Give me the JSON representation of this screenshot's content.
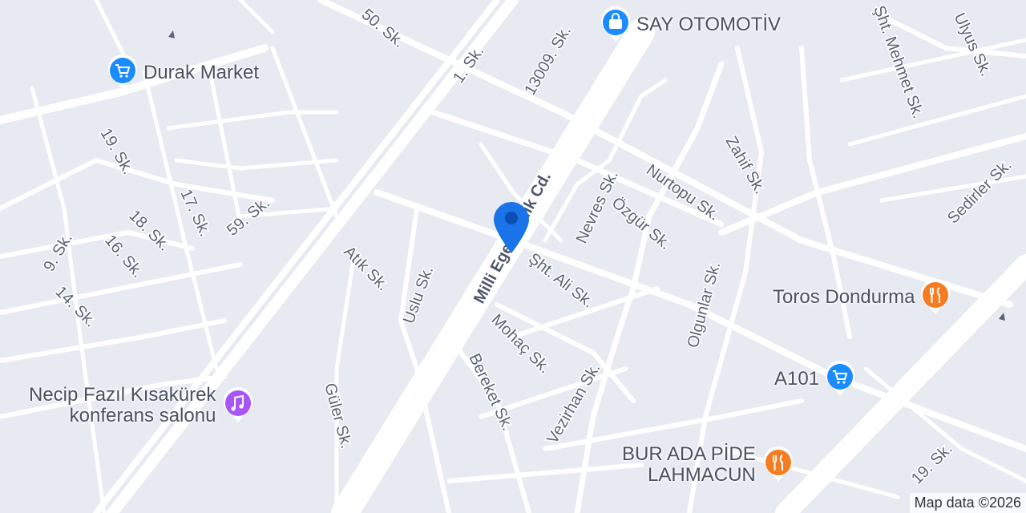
{
  "map": {
    "colors": {
      "background": "#e8eaf1",
      "road": "#ffffff",
      "text": "#5b6477",
      "pin": "#1a73e8",
      "shop": "#1a8cff",
      "food": "#f57c20",
      "music": "#a855f7"
    },
    "attribution": "Map data ©2026"
  },
  "streets": [
    "50. Sk.",
    "1. Sk.",
    "13009. Sk.",
    "Milli Egemenlik Cd.",
    "19. Sk.",
    "17. Sk.",
    "18. Sk.",
    "59. Sk.",
    "9. Sk.",
    "16. Sk.",
    "14. Sk.",
    "Atık Sk.",
    "Uslu Sk.",
    "Güler Sk.",
    "Nevres Sk.",
    "Nurtopu Sk.",
    "Özgür Sk.",
    "Şht. Ali Sk.",
    "Mohaç Sk.",
    "Bereket Sk.",
    "Vezirhan Sk.",
    "Olgunlar Sk.",
    "Zahif Sk.",
    "Şht. Mehmet Sk.",
    "Ulyus Sk.",
    "Sedirler Sk.",
    "19. Sk."
  ],
  "pois": [
    {
      "name": "Durak Market",
      "icon": "shopping-cart-icon"
    },
    {
      "name": "SAY OTOMOTİV",
      "icon": "shopping-bag-icon"
    },
    {
      "name": "Toros Dondurma",
      "icon": "restaurant-icon"
    },
    {
      "name": "A101",
      "icon": "shopping-cart-icon"
    },
    {
      "line1": "Necip Fazıl Kısakürek",
      "line2": "konferans salonu",
      "icon": "music-icon"
    },
    {
      "line1": "BUR ADA PİDE",
      "line2": "LAHMACUN",
      "icon": "restaurant-icon"
    }
  ],
  "selected_pin": {
    "icon": "location-pin-icon"
  }
}
